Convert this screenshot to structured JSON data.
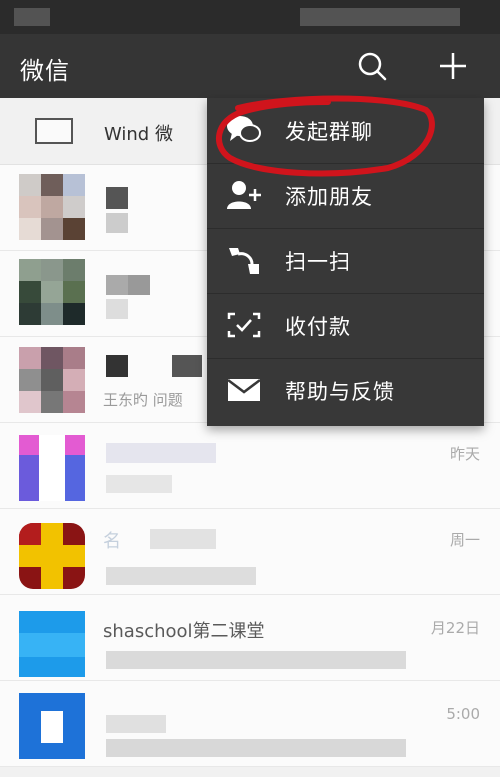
{
  "header": {
    "title": "微信"
  },
  "pc_login": {
    "text": "Wind   微"
  },
  "menu": {
    "items": [
      {
        "label": "发起群聊",
        "icon": "chat-bubbles-icon"
      },
      {
        "label": "添加朋友",
        "icon": "add-user-icon"
      },
      {
        "label": "扫一扫",
        "icon": "scan-icon"
      },
      {
        "label": "收付款",
        "icon": "payment-icon"
      },
      {
        "label": "帮助与反馈",
        "icon": "mail-icon"
      }
    ]
  },
  "chats": [
    {
      "name": "",
      "sub": "",
      "time": ""
    },
    {
      "name": "",
      "sub": "",
      "time": ""
    },
    {
      "name": "",
      "sub": "王东旳    问题",
      "time": ""
    },
    {
      "name": "",
      "sub": "",
      "time": "昨天"
    },
    {
      "name": "名",
      "sub": "",
      "time": "周一"
    },
    {
      "name": "shaschool第二课堂",
      "sub": "",
      "time": "月22日"
    },
    {
      "name": "",
      "sub": "",
      "time": "5:00"
    }
  ],
  "colors": {
    "topbar": "#353535",
    "menu": "#383838",
    "annotation": "#d0141c"
  }
}
